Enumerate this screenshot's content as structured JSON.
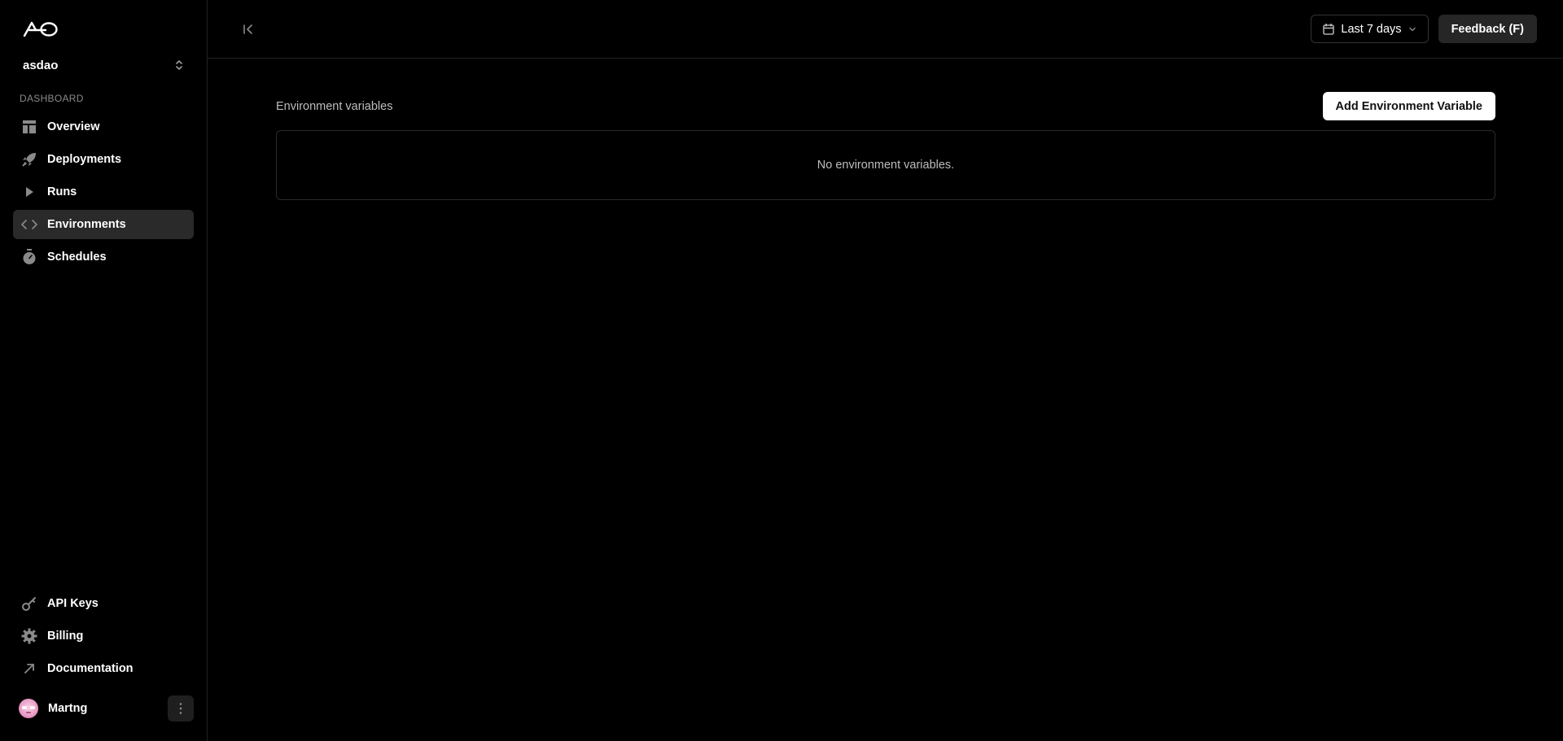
{
  "sidebar": {
    "project_name": "asdao",
    "section_label": "DASHBOARD",
    "nav": [
      {
        "label": "Overview",
        "icon": "layout-icon"
      },
      {
        "label": "Deployments",
        "icon": "rocket-icon"
      },
      {
        "label": "Runs",
        "icon": "play-icon"
      },
      {
        "label": "Environments",
        "icon": "code-icon",
        "active": true
      },
      {
        "label": "Schedules",
        "icon": "timer-icon"
      }
    ],
    "bottom_nav": [
      {
        "label": "API Keys",
        "icon": "key-icon"
      },
      {
        "label": "Billing",
        "icon": "gear-icon"
      },
      {
        "label": "Documentation",
        "icon": "external-arrow-icon"
      }
    ],
    "user": {
      "name": "Martng"
    }
  },
  "topbar": {
    "date_range": "Last 7 days",
    "feedback_label": "Feedback (F)"
  },
  "content": {
    "title": "Environment variables",
    "add_button": "Add Environment Variable",
    "empty_text": "No environment variables."
  },
  "colors": {
    "background": "#000000",
    "active_nav": "#2a2a2a",
    "border": "#222222",
    "primary_button": "#ffffff",
    "secondary_button": "#262626"
  }
}
